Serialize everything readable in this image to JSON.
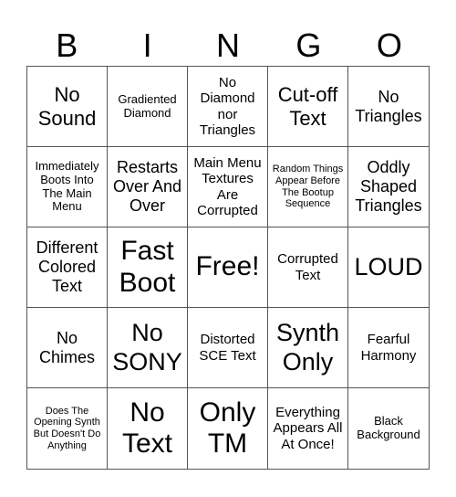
{
  "header": {
    "letters": [
      "B",
      "I",
      "N",
      "G",
      "O"
    ]
  },
  "cells": [
    {
      "text": "No Sound",
      "size": "s-xl"
    },
    {
      "text": "Gradiented Diamond",
      "size": "s-sm"
    },
    {
      "text": "No Diamond nor Triangles",
      "size": "s-md"
    },
    {
      "text": "Cut-off Text",
      "size": "s-xl"
    },
    {
      "text": "No Triangles",
      "size": "s-lg"
    },
    {
      "text": "Immediately Boots Into The Main Menu",
      "size": "s-sm"
    },
    {
      "text": "Restarts Over And Over",
      "size": "s-lg"
    },
    {
      "text": "Main Menu Textures Are Corrupted",
      "size": "s-md"
    },
    {
      "text": "Random Things Appear Before The Bootup Sequence",
      "size": "s-xs"
    },
    {
      "text": "Oddly Shaped Triangles",
      "size": "s-lg"
    },
    {
      "text": "Different Colored Text",
      "size": "s-lg"
    },
    {
      "text": "Fast Boot",
      "size": "s-huge"
    },
    {
      "text": "Free!",
      "size": "s-huge"
    },
    {
      "text": "Corrupted Text",
      "size": "s-md"
    },
    {
      "text": "LOUD",
      "size": "s-xxl"
    },
    {
      "text": "No Chimes",
      "size": "s-lg"
    },
    {
      "text": "No SONY",
      "size": "s-xxl"
    },
    {
      "text": "Distorted SCE Text",
      "size": "s-md"
    },
    {
      "text": "Synth Only",
      "size": "s-xxl"
    },
    {
      "text": "Fearful Harmony",
      "size": "s-md"
    },
    {
      "text": "Does The Opening Synth But Doesn't Do Anything",
      "size": "s-xs"
    },
    {
      "text": "No Text",
      "size": "s-huge"
    },
    {
      "text": "Only TM",
      "size": "s-huge"
    },
    {
      "text": "Everything Appears All At Once!",
      "size": "s-md"
    },
    {
      "text": "Black Background",
      "size": "s-sm"
    }
  ]
}
